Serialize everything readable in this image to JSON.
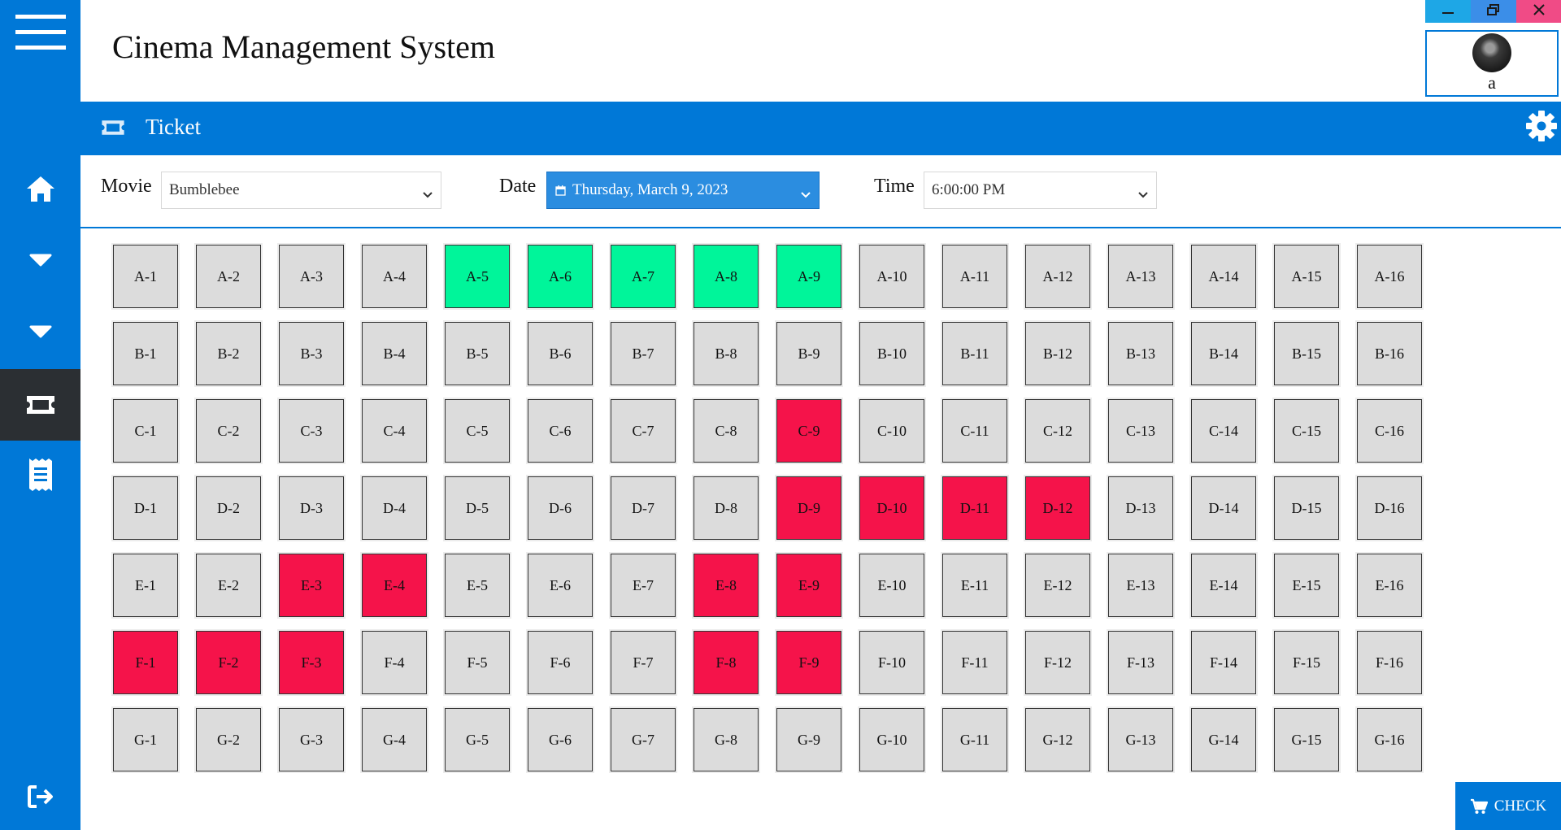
{
  "app": {
    "title": "Cinema Management System"
  },
  "window_controls": [
    {
      "name": "minimize-button",
      "icon": "minimize-icon",
      "color": "#1ea7e6"
    },
    {
      "name": "restore-button",
      "icon": "restore-icon",
      "color": "#3b8ee8"
    },
    {
      "name": "close-button",
      "icon": "close-icon",
      "color": "#f04b86"
    }
  ],
  "user": {
    "name": "a"
  },
  "sidebar": {
    "items": [
      {
        "icon": "menu-icon"
      },
      {
        "icon": "home-icon"
      },
      {
        "icon": "chevron-down-icon"
      },
      {
        "icon": "chevron-down-icon"
      },
      {
        "icon": "ticket-icon",
        "active": true
      },
      {
        "icon": "receipt-icon"
      },
      {
        "icon": "logout-icon"
      }
    ]
  },
  "page": {
    "title": "Ticket",
    "settings_icon": "gear-icon"
  },
  "filters": {
    "movie": {
      "label": "Movie",
      "value": "Bumblebee"
    },
    "date": {
      "label": "Date",
      "value": "Thursday, March 9, 2023",
      "icon": "calendar-icon"
    },
    "time": {
      "label": "Time",
      "value": "6:00:00 PM"
    }
  },
  "seats": {
    "rows": [
      "A",
      "B",
      "C",
      "D",
      "E",
      "F",
      "G"
    ],
    "columns": [
      1,
      2,
      3,
      4,
      5,
      6,
      7,
      8,
      9,
      10,
      11,
      12,
      13,
      14,
      15,
      16
    ],
    "selected": [
      "A-5",
      "A-6",
      "A-7",
      "A-8",
      "A-9"
    ],
    "booked": [
      "C-9",
      "D-9",
      "D-10",
      "D-11",
      "D-12",
      "E-3",
      "E-4",
      "E-8",
      "E-9",
      "F-1",
      "F-2",
      "F-3",
      "F-8",
      "F-9"
    ],
    "colors": {
      "available": "#dcdcdc",
      "selected": "#00f59a",
      "booked": "#f5134a"
    }
  },
  "actions": {
    "check_label": "CHECK",
    "check_icon": "cart-icon"
  }
}
